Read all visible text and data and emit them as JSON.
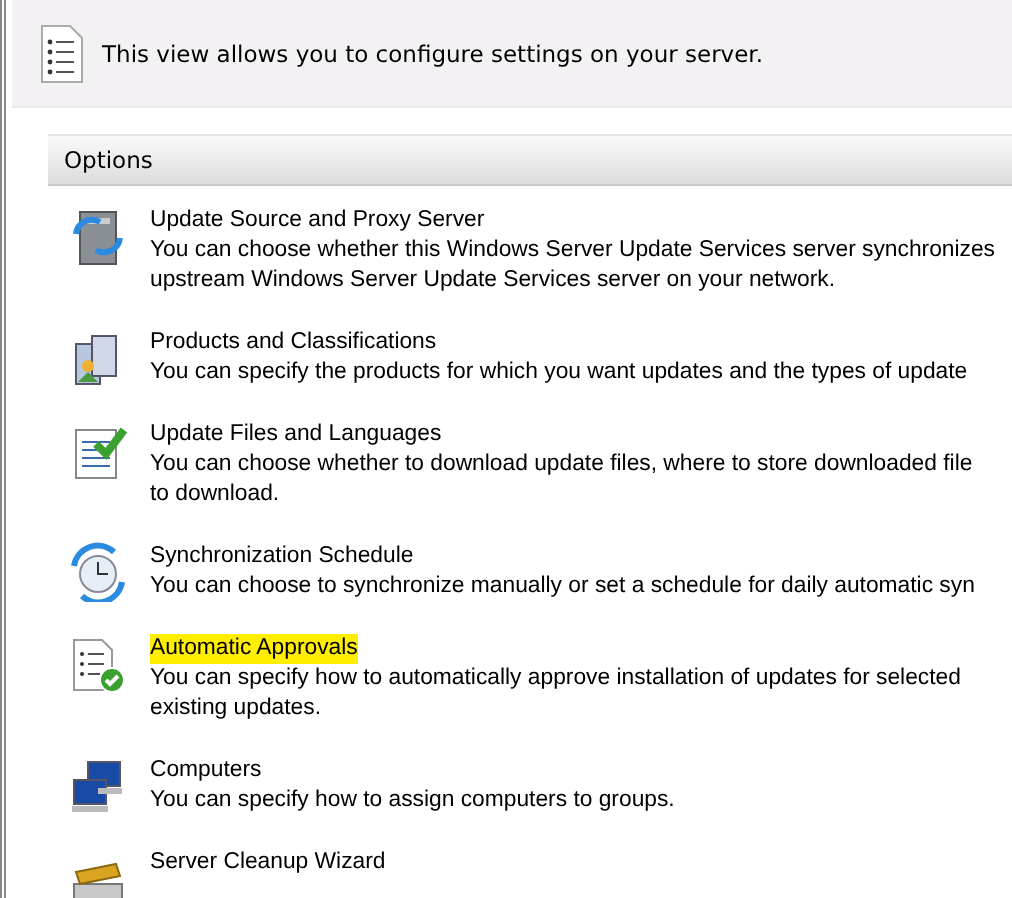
{
  "banner": {
    "text": "This view allows you to configure settings on your server."
  },
  "options": {
    "title": "Options",
    "items": [
      {
        "kind": "source",
        "title": "Update Source and Proxy Server",
        "highlighted": false,
        "description": [
          "You can choose whether this Windows Server Update Services server synchronizes",
          "upstream Windows Server Update Services server on your network."
        ]
      },
      {
        "kind": "products",
        "title": "Products and Classifications",
        "highlighted": false,
        "description": [
          "You can specify the products for which you want updates and the types of update"
        ]
      },
      {
        "kind": "files",
        "title": "Update Files and Languages",
        "highlighted": false,
        "description": [
          "You can choose whether to download update files, where to store downloaded file",
          "to download."
        ]
      },
      {
        "kind": "schedule",
        "title": "Synchronization Schedule",
        "highlighted": false,
        "description": [
          "You can choose to synchronize manually or set a schedule for daily automatic syn"
        ]
      },
      {
        "kind": "approvals",
        "title": "Automatic Approvals",
        "highlighted": true,
        "description": [
          "You can specify how to automatically approve installation of updates for selected",
          "existing updates."
        ]
      },
      {
        "kind": "computers",
        "title": "Computers",
        "highlighted": false,
        "description": [
          "You can specify how to assign computers to groups."
        ]
      },
      {
        "kind": "cleanup",
        "title": "Server Cleanup Wizard",
        "highlighted": false
      }
    ]
  }
}
